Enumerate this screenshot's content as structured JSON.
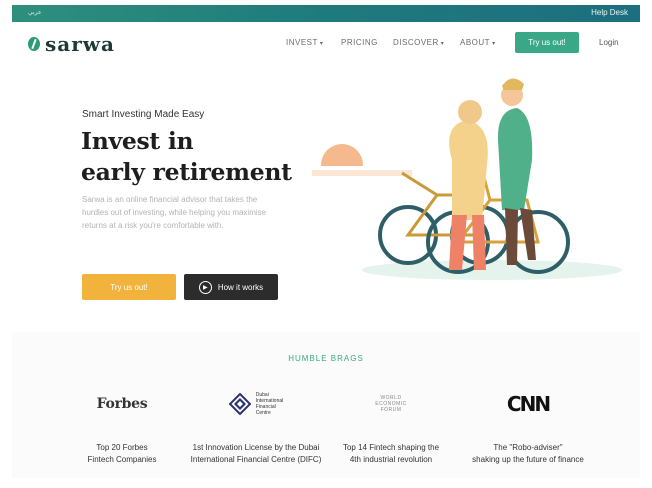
{
  "topbar": {
    "arabic_label": "عربي",
    "help_desk": "Help Desk"
  },
  "header": {
    "logo_text": "sarwa",
    "nav": [
      {
        "label": "INVEST",
        "caret": "▾"
      },
      {
        "label": "PRICING",
        "caret": ""
      },
      {
        "label": "DISCOVER",
        "caret": "▾"
      },
      {
        "label": "ABOUT",
        "caret": "▾"
      }
    ],
    "cta": "Try us out!",
    "login": "Login"
  },
  "hero": {
    "eyebrow": "Smart Investing Made Easy",
    "headline_line1": "Invest in",
    "headline_line2": "early retirement",
    "description": "Sarwa is an online financial advisor that takes the hurdles out of investing, while helping you maximise returns at a risk you're comfortable with.",
    "try_button": "Try us out!",
    "how_button": "How it works"
  },
  "brags": {
    "title": "HUMBLE BRAGS",
    "items": [
      {
        "logo": "Forbes",
        "caption_line1": "Top 20 Forbes",
        "caption_line2": "Fintech Companies"
      },
      {
        "logo_lines": [
          "Dubai",
          "International",
          "Financial",
          "Centre"
        ],
        "caption_line1": "1st Innovation License by the Dubai",
        "caption_line2": "International Financial Centre (DIFC)"
      },
      {
        "logo_lines": [
          "WORLD",
          "ECONOMIC",
          "FORUM"
        ],
        "caption_line1": "Top 14 Fintech shaping the",
        "caption_line2": "4th industrial revolution"
      },
      {
        "logo": "CNN",
        "caption_line1": "The \"Robo-adviser\"",
        "caption_line2": "shaking up the future of finance"
      }
    ]
  },
  "colors": {
    "brand_green": "#3aa886",
    "accent_yellow": "#f2b33d",
    "dark_button": "#2c2c2c"
  }
}
